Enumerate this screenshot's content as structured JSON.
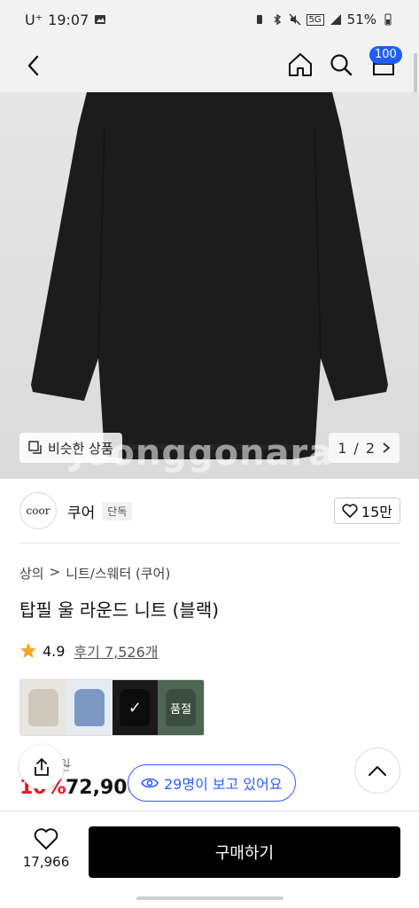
{
  "status_bar": {
    "carrier": "U⁺",
    "time": "19:07",
    "network": "5G",
    "battery": "51%"
  },
  "nav": {
    "cart_count": "100"
  },
  "image": {
    "watermark": "Joonggonara",
    "similar_label": "비슷한 상품",
    "page_current": "1",
    "page_sep": "/",
    "page_total": "2"
  },
  "brand": {
    "logo_text": "coor",
    "name": "쿠어",
    "badge": "단독",
    "likes": "15만"
  },
  "breadcrumb": {
    "level1": "상의",
    "separator": ">",
    "level2": "니트/스웨터 (쿠어)"
  },
  "product": {
    "title": "탑필 울 라운드 니트 (블랙)",
    "rating": "4.9",
    "reviews": "후기 7,526개",
    "original_price": "원",
    "discount": "10%",
    "price": "72,900"
  },
  "swatches": [
    {
      "name": "beige",
      "sold_out": ""
    },
    {
      "name": "blue",
      "sold_out": ""
    },
    {
      "name": "black",
      "sold_out": ""
    },
    {
      "name": "green",
      "sold_out": "품절"
    }
  ],
  "viewers": "29명이 보고 있어요",
  "bottom": {
    "wish_count": "17,966",
    "buy_label": "구매하기"
  },
  "colors": {
    "accent": "#2d5cff",
    "discount": "#e8192c",
    "rating_star": "#f5a623"
  }
}
